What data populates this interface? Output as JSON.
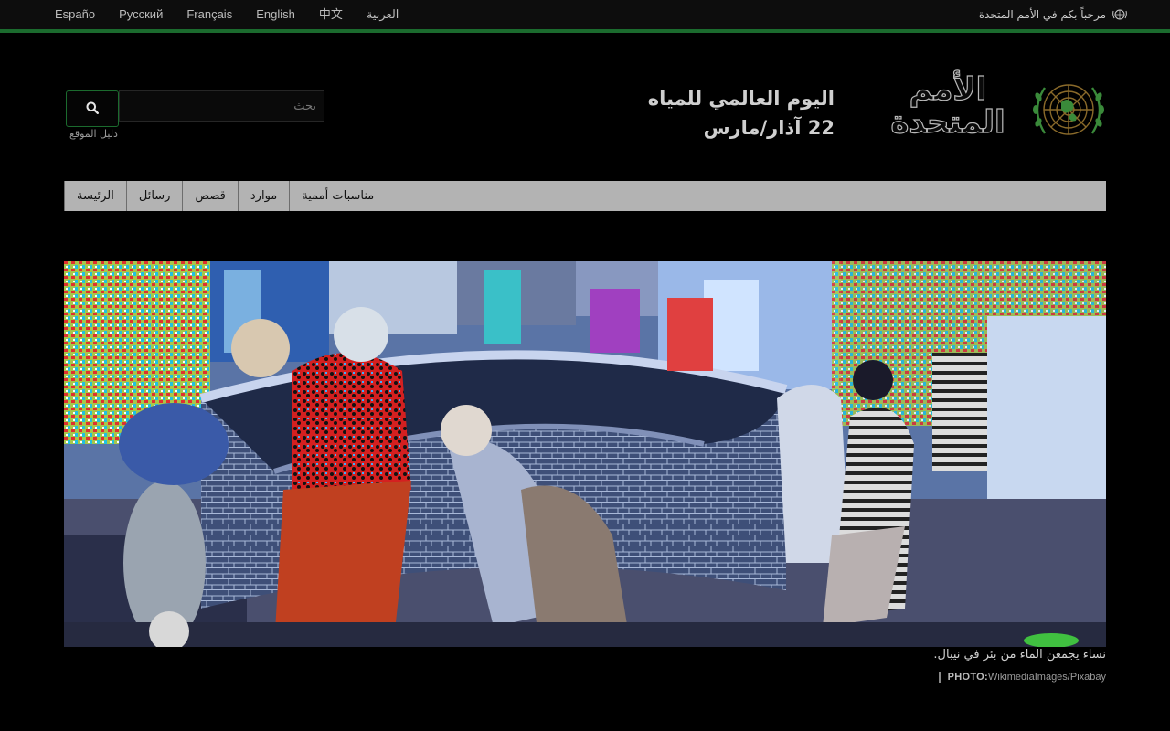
{
  "topbar": {
    "languages": [
      "Españo",
      "Pусский",
      "Français",
      "English",
      "中文",
      "العربية"
    ],
    "welcome": "مرحباً بكم في الأمم المتحدة"
  },
  "header": {
    "org_name_line1": "الأمم",
    "org_name_line2": "المتحدة",
    "event_title": "اليوم العالمي للمياه",
    "event_date": "22 آذار/مارس"
  },
  "search": {
    "placeholder": "بحث",
    "sitemap_label": "دليل الموقع"
  },
  "nav": {
    "items": [
      "الرئيسة",
      "رسائل",
      "قصص",
      "موارد",
      "مناسبات أممية"
    ]
  },
  "hero": {
    "caption": "نساء يجمعن الماء من بئر في نيبال.",
    "credit_label": "PHOTO:",
    "credit_source": "WikimediaImages/Pixabay"
  },
  "colors": {
    "accent_green": "#1b6b2e",
    "nav_bg": "#b3b3b3"
  }
}
